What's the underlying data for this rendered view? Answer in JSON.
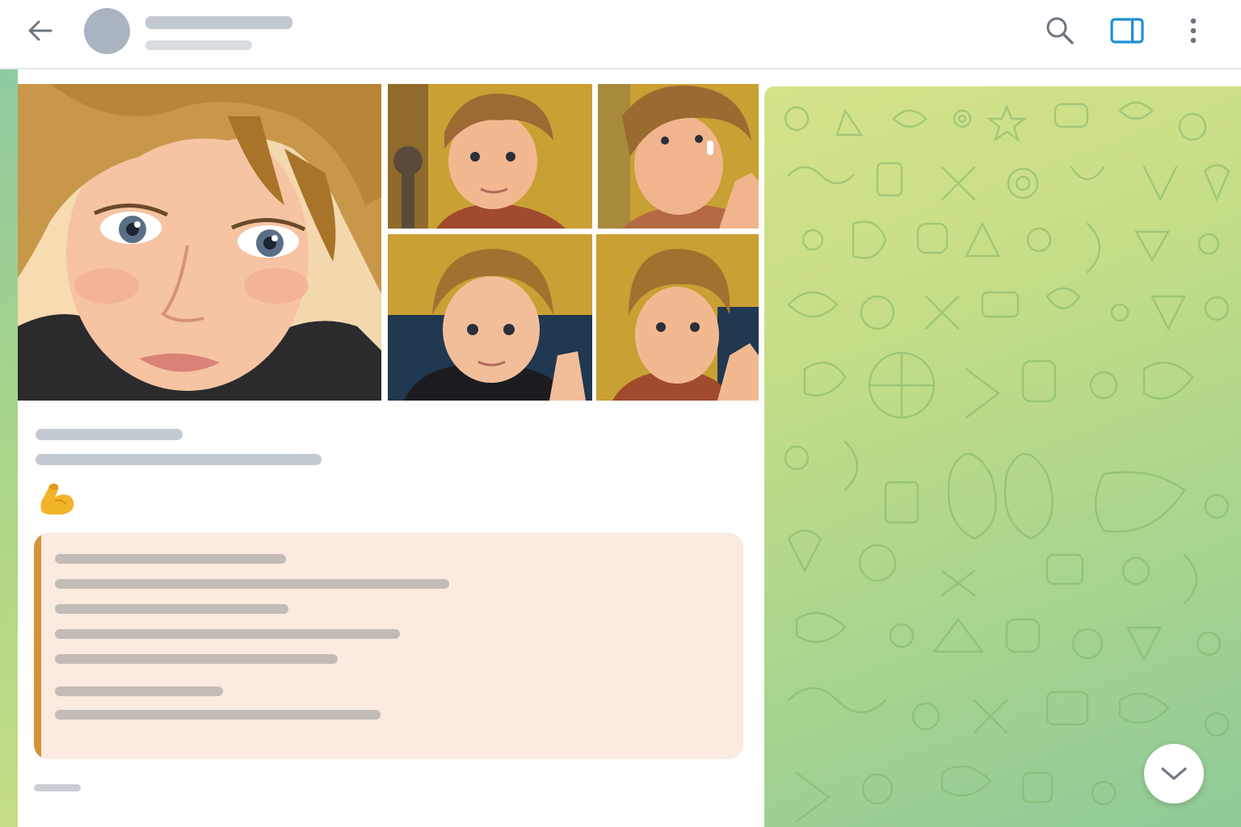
{
  "header": {
    "back_icon": "arrow-left-icon",
    "search_icon": "search-icon",
    "sidebar_icon": "sidebar-panel-icon",
    "more_icon": "more-vertical-icon"
  },
  "message": {
    "photos": [
      {
        "name": "photo-large"
      },
      {
        "name": "photo-1"
      },
      {
        "name": "photo-2"
      },
      {
        "name": "photo-3"
      },
      {
        "name": "photo-4"
      }
    ],
    "emoji": "💪"
  },
  "wallpaper": {
    "scroll_down_icon": "chevron-down-icon"
  },
  "colors": {
    "accent": "#1f8fd6",
    "quote_bar": "#d49338",
    "quote_bg": "#faeadf",
    "wallpaper_top": "#d4e38a",
    "wallpaper_bottom": "#8fca98"
  }
}
